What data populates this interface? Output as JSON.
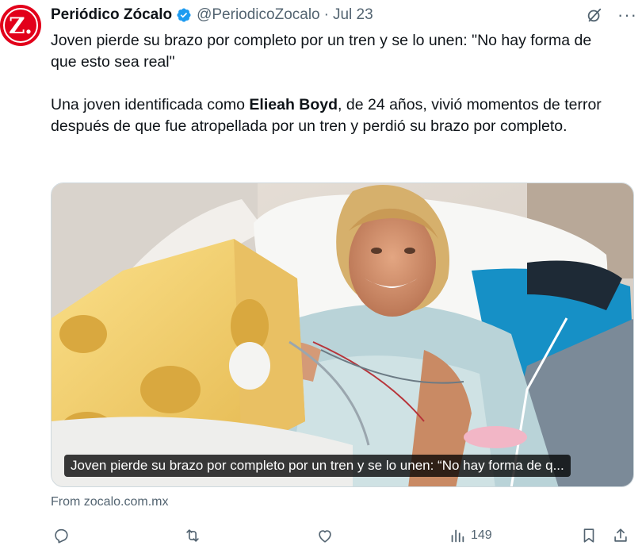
{
  "avatar": {
    "letter": "Z."
  },
  "author": {
    "name": "Periódico Zócalo",
    "handle": "@PeriodicoZocalo",
    "separator": "·",
    "date": "Jul 23"
  },
  "tweet": {
    "headline": "Joven pierde su brazo por completo por un tren y se lo unen: \"No hay forma de que esto sea real\"",
    "body_before": "Una joven identificada como ",
    "body_bold": "Elieah Boyd",
    "body_after": ", de 24 años, vivió momentos de terror después de que fue atropellada por un tren y perdió su brazo por completo."
  },
  "card": {
    "caption": "Joven pierde su brazo por completo por un tren y se lo unen: “No hay forma de q...",
    "source": "From zocalo.com.mx"
  },
  "actions": {
    "views_count": "149"
  },
  "colors": {
    "brand_red": "#e2001a",
    "verified_blue": "#1d9bf0",
    "secondary_text": "#536471"
  },
  "icons": [
    "verified-badge-icon",
    "grok-icon",
    "more-icon",
    "reply-icon",
    "retweet-icon",
    "like-icon",
    "views-icon",
    "bookmark-icon",
    "share-icon"
  ]
}
